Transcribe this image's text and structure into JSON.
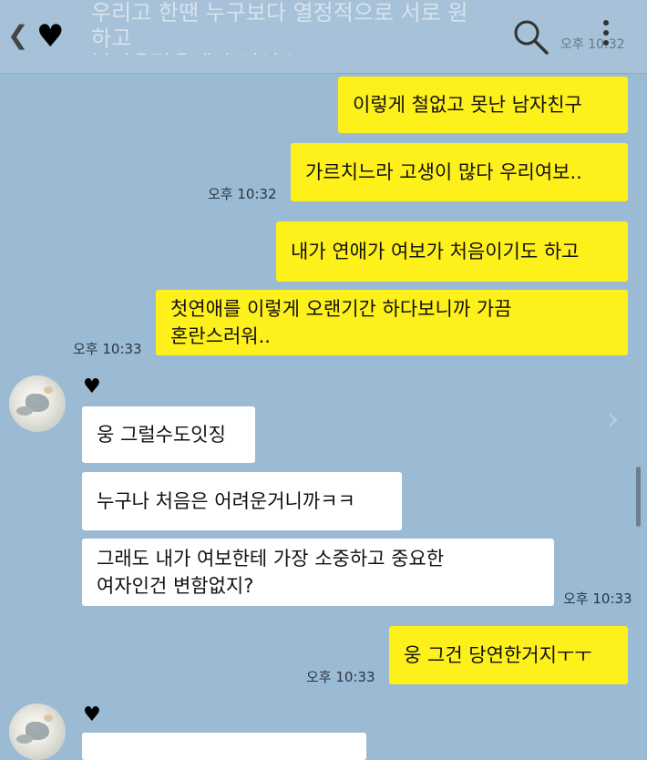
{
  "header": {
    "back_glyph": "❮",
    "title": "♥",
    "banner_text": "우리고 한땐 누구보다 열정적으로 서로 원하고\n불타올랐을때가 잇엇오!",
    "ghost_time": "오후 10:32"
  },
  "messages": {
    "m1": "이렇게 철없고 못난 남자친구",
    "m2": "가르치느라 고생이 많다 우리여보..",
    "t1": "오후 10:32",
    "m3": "내가 연애가 여보가 처음이기도 하고",
    "m4": "첫연애를 이렇게 오랜기간 하다보니까 가끔\n혼란스러워..",
    "t2": "오후 10:33",
    "sender1_name": "♥",
    "r1": "웅 그럴수도잇징",
    "r2": "누구나 처음은 어려운거니까ㅋㅋ",
    "r3": "그래도 내가 여보한테 가장 소중하고 중요한\n여자인건 변함없지?",
    "t3": "오후 10:33",
    "m5": "웅 그건 당연한거지ㅜㅜ",
    "t4": "오후 10:33",
    "sender2_name": "♥"
  },
  "colors": {
    "background": "#9bbbd4",
    "my_bubble": "#fef01b",
    "their_bubble": "#ffffff"
  },
  "icons": {
    "back": "chevron-left-icon",
    "search": "search-icon",
    "menu": "more-vertical-icon"
  }
}
